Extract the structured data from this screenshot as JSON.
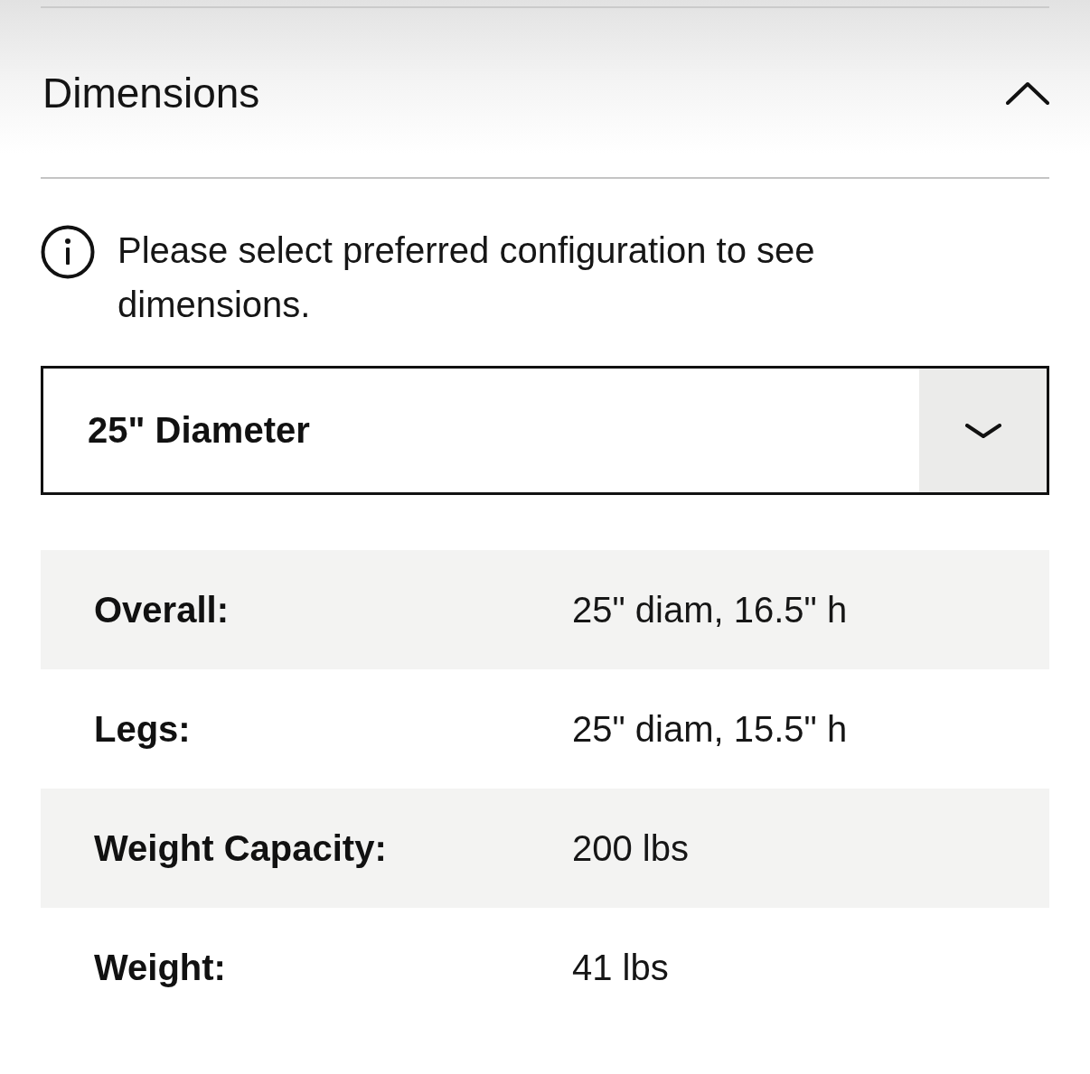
{
  "section": {
    "title": "Dimensions",
    "expanded": true
  },
  "info": {
    "message": "Please select preferred configuration to see dimensions."
  },
  "configuration_select": {
    "value": "25\" Diameter"
  },
  "specs": [
    {
      "label": "Overall:",
      "value": "25\" diam, 16.5\" h"
    },
    {
      "label": "Legs:",
      "value": "25\" diam, 15.5\" h"
    },
    {
      "label": "Weight Capacity:",
      "value": "200 lbs"
    },
    {
      "label": "Weight:",
      "value": "41 lbs"
    }
  ]
}
